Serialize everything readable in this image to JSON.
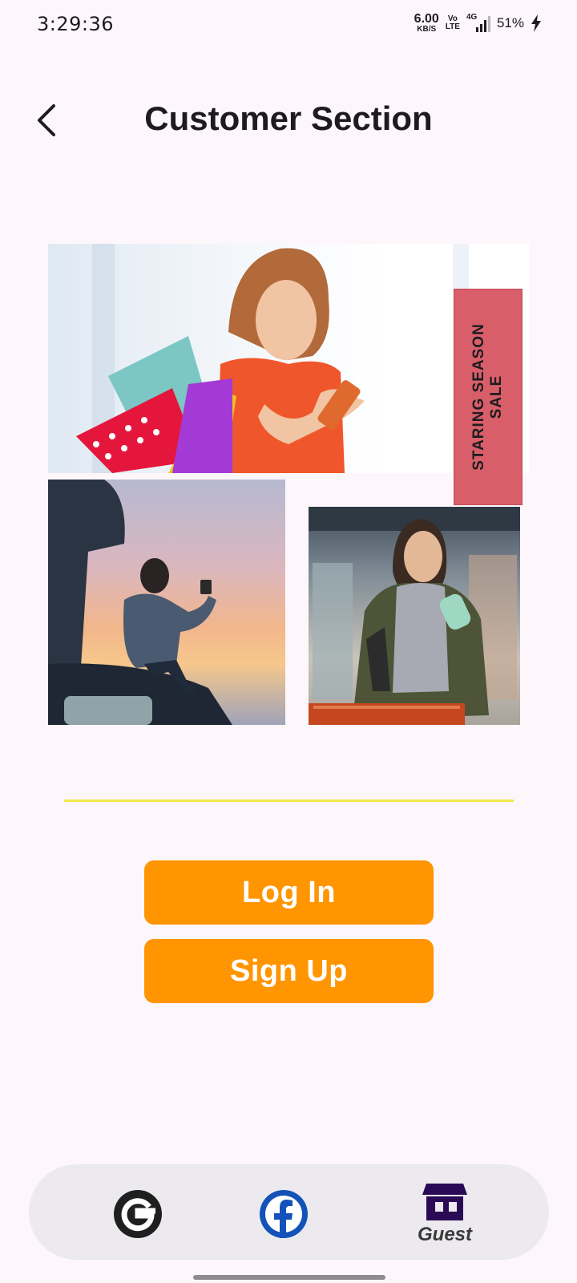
{
  "status_bar": {
    "time": "3:29:36",
    "net_speed_value": "6.00",
    "net_speed_unit": "KB/S",
    "volte_top": "Vo",
    "volte_bottom": "LTE",
    "network": "4G",
    "battery": "51%"
  },
  "app_bar": {
    "title": "Customer Section",
    "back_icon": "back-arrow-icon"
  },
  "collage": {
    "sale_banner": "STARING SEASON\nSALE",
    "images": [
      "woman-with-shopping-bags-photo",
      "woman-on-van-at-sunset-photo",
      "woman-grocery-shopping-photo"
    ]
  },
  "colors": {
    "accent_button": "#ff9500",
    "divider": "#f1e84c",
    "sale_banner": "#d85f6a",
    "guest_icon": "#2a0a55",
    "facebook": "#1352b8"
  },
  "actions": {
    "login_label": "Log In",
    "signup_label": "Sign Up"
  },
  "bottom_nav": {
    "google_icon": "google-icon",
    "facebook_icon": "facebook-icon",
    "guest_icon": "store-icon",
    "guest_label": "Guest"
  }
}
